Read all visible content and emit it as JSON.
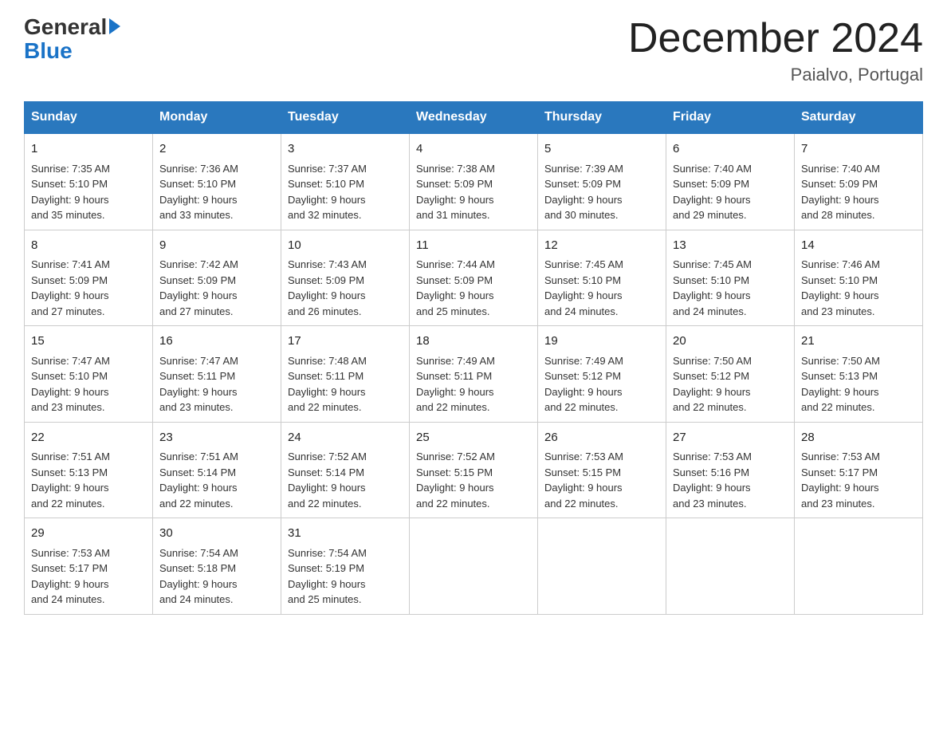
{
  "logo": {
    "general": "General",
    "blue": "Blue",
    "arrow": "▶"
  },
  "title": "December 2024",
  "subtitle": "Paialvo, Portugal",
  "days_of_week": [
    "Sunday",
    "Monday",
    "Tuesday",
    "Wednesday",
    "Thursday",
    "Friday",
    "Saturday"
  ],
  "weeks": [
    [
      {
        "day": "1",
        "sunrise": "7:35 AM",
        "sunset": "5:10 PM",
        "daylight": "9 hours and 35 minutes."
      },
      {
        "day": "2",
        "sunrise": "7:36 AM",
        "sunset": "5:10 PM",
        "daylight": "9 hours and 33 minutes."
      },
      {
        "day": "3",
        "sunrise": "7:37 AM",
        "sunset": "5:10 PM",
        "daylight": "9 hours and 32 minutes."
      },
      {
        "day": "4",
        "sunrise": "7:38 AM",
        "sunset": "5:09 PM",
        "daylight": "9 hours and 31 minutes."
      },
      {
        "day": "5",
        "sunrise": "7:39 AM",
        "sunset": "5:09 PM",
        "daylight": "9 hours and 30 minutes."
      },
      {
        "day": "6",
        "sunrise": "7:40 AM",
        "sunset": "5:09 PM",
        "daylight": "9 hours and 29 minutes."
      },
      {
        "day": "7",
        "sunrise": "7:40 AM",
        "sunset": "5:09 PM",
        "daylight": "9 hours and 28 minutes."
      }
    ],
    [
      {
        "day": "8",
        "sunrise": "7:41 AM",
        "sunset": "5:09 PM",
        "daylight": "9 hours and 27 minutes."
      },
      {
        "day": "9",
        "sunrise": "7:42 AM",
        "sunset": "5:09 PM",
        "daylight": "9 hours and 27 minutes."
      },
      {
        "day": "10",
        "sunrise": "7:43 AM",
        "sunset": "5:09 PM",
        "daylight": "9 hours and 26 minutes."
      },
      {
        "day": "11",
        "sunrise": "7:44 AM",
        "sunset": "5:09 PM",
        "daylight": "9 hours and 25 minutes."
      },
      {
        "day": "12",
        "sunrise": "7:45 AM",
        "sunset": "5:10 PM",
        "daylight": "9 hours and 24 minutes."
      },
      {
        "day": "13",
        "sunrise": "7:45 AM",
        "sunset": "5:10 PM",
        "daylight": "9 hours and 24 minutes."
      },
      {
        "day": "14",
        "sunrise": "7:46 AM",
        "sunset": "5:10 PM",
        "daylight": "9 hours and 23 minutes."
      }
    ],
    [
      {
        "day": "15",
        "sunrise": "7:47 AM",
        "sunset": "5:10 PM",
        "daylight": "9 hours and 23 minutes."
      },
      {
        "day": "16",
        "sunrise": "7:47 AM",
        "sunset": "5:11 PM",
        "daylight": "9 hours and 23 minutes."
      },
      {
        "day": "17",
        "sunrise": "7:48 AM",
        "sunset": "5:11 PM",
        "daylight": "9 hours and 22 minutes."
      },
      {
        "day": "18",
        "sunrise": "7:49 AM",
        "sunset": "5:11 PM",
        "daylight": "9 hours and 22 minutes."
      },
      {
        "day": "19",
        "sunrise": "7:49 AM",
        "sunset": "5:12 PM",
        "daylight": "9 hours and 22 minutes."
      },
      {
        "day": "20",
        "sunrise": "7:50 AM",
        "sunset": "5:12 PM",
        "daylight": "9 hours and 22 minutes."
      },
      {
        "day": "21",
        "sunrise": "7:50 AM",
        "sunset": "5:13 PM",
        "daylight": "9 hours and 22 minutes."
      }
    ],
    [
      {
        "day": "22",
        "sunrise": "7:51 AM",
        "sunset": "5:13 PM",
        "daylight": "9 hours and 22 minutes."
      },
      {
        "day": "23",
        "sunrise": "7:51 AM",
        "sunset": "5:14 PM",
        "daylight": "9 hours and 22 minutes."
      },
      {
        "day": "24",
        "sunrise": "7:52 AM",
        "sunset": "5:14 PM",
        "daylight": "9 hours and 22 minutes."
      },
      {
        "day": "25",
        "sunrise": "7:52 AM",
        "sunset": "5:15 PM",
        "daylight": "9 hours and 22 minutes."
      },
      {
        "day": "26",
        "sunrise": "7:53 AM",
        "sunset": "5:15 PM",
        "daylight": "9 hours and 22 minutes."
      },
      {
        "day": "27",
        "sunrise": "7:53 AM",
        "sunset": "5:16 PM",
        "daylight": "9 hours and 23 minutes."
      },
      {
        "day": "28",
        "sunrise": "7:53 AM",
        "sunset": "5:17 PM",
        "daylight": "9 hours and 23 minutes."
      }
    ],
    [
      {
        "day": "29",
        "sunrise": "7:53 AM",
        "sunset": "5:17 PM",
        "daylight": "9 hours and 24 minutes."
      },
      {
        "day": "30",
        "sunrise": "7:54 AM",
        "sunset": "5:18 PM",
        "daylight": "9 hours and 24 minutes."
      },
      {
        "day": "31",
        "sunrise": "7:54 AM",
        "sunset": "5:19 PM",
        "daylight": "9 hours and 25 minutes."
      },
      null,
      null,
      null,
      null
    ]
  ],
  "labels": {
    "sunrise": "Sunrise:",
    "sunset": "Sunset:",
    "daylight": "Daylight:"
  }
}
